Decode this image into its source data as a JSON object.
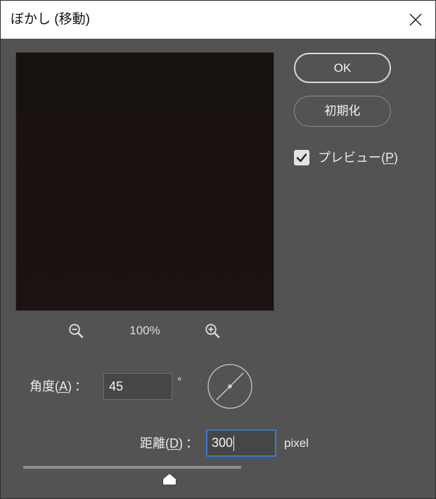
{
  "window": {
    "title": "ぼかし (移動)"
  },
  "icons": {
    "close": "close-icon",
    "zoom_out": "zoom-out-icon",
    "zoom_in": "zoom-in-icon",
    "checkbox_check": "check-icon"
  },
  "colors": {
    "panel": "#535353",
    "preview_background": "#1a1312",
    "focus_border": "#3b78d8"
  },
  "preview": {
    "zoom_level": "100%"
  },
  "buttons": {
    "ok": "OK",
    "reset": "初期化"
  },
  "preview_toggle": {
    "label_before": "プレビュー(",
    "mnemonic": "P",
    "label_after": ")",
    "checked": true
  },
  "angle": {
    "label_before": "角度(",
    "mnemonic": "A",
    "label_after": ")",
    "separator": "：",
    "value": "45",
    "unit": "°"
  },
  "distance": {
    "label_before": "距離(",
    "mnemonic": "D",
    "label_after": ")",
    "separator": "：",
    "value": "300",
    "unit": "pixel",
    "slider_fraction": 0.67
  }
}
